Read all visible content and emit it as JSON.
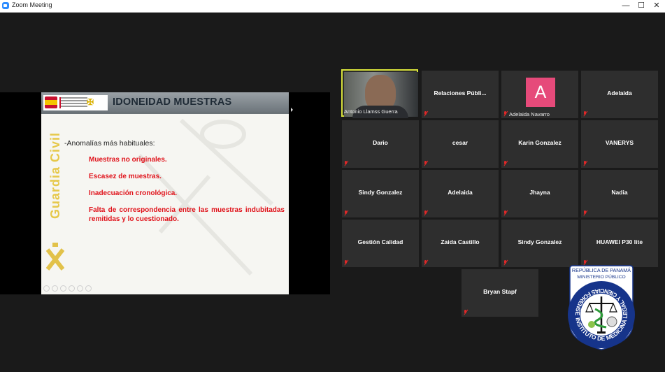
{
  "window": {
    "title": "Zoom Meeting",
    "minimize_glyph": "—",
    "maximize_glyph": "☐",
    "close_glyph": "✕"
  },
  "slide": {
    "title": "IDONEIDAD MUESTRAS",
    "brand_vertical": "Guardia Civil",
    "intro": "-Anomalías más habituales:",
    "items": [
      "Muestras no originales.",
      "Escasez de muestras.",
      "Inadecuación cronológica.",
      "Falta de correspondencia entre las muestras indubitadas remitidas y lo cuestionado."
    ],
    "accent_color": "#e0121a"
  },
  "participants": {
    "active_speaker": "Antonio Llamss Guerra",
    "avatar_letter": "A",
    "avatar_name": "Adelaida Navarro",
    "tiles": [
      "Relaciones  Públi...",
      "Adelaida",
      "Dario",
      "cesar",
      "Karin Gonzalez",
      "VANERYS",
      "Sindy Gonzalez",
      "Adelaida",
      "Jhayna",
      "Nadia",
      "Gestión Calidad",
      "Zaida Castillo",
      "Sindy Gonzalez",
      "HUAWEI P30 lite",
      "Bryan Stapf"
    ]
  },
  "overlay_logo": {
    "line1": "REPÚBLICA DE PANAMÁ",
    "line2": "MINISTERIO PÚBLICO",
    "ring_text": "INSTITUTO DE MEDICINA LEGAL Y CIENCIAS FORENSES"
  }
}
